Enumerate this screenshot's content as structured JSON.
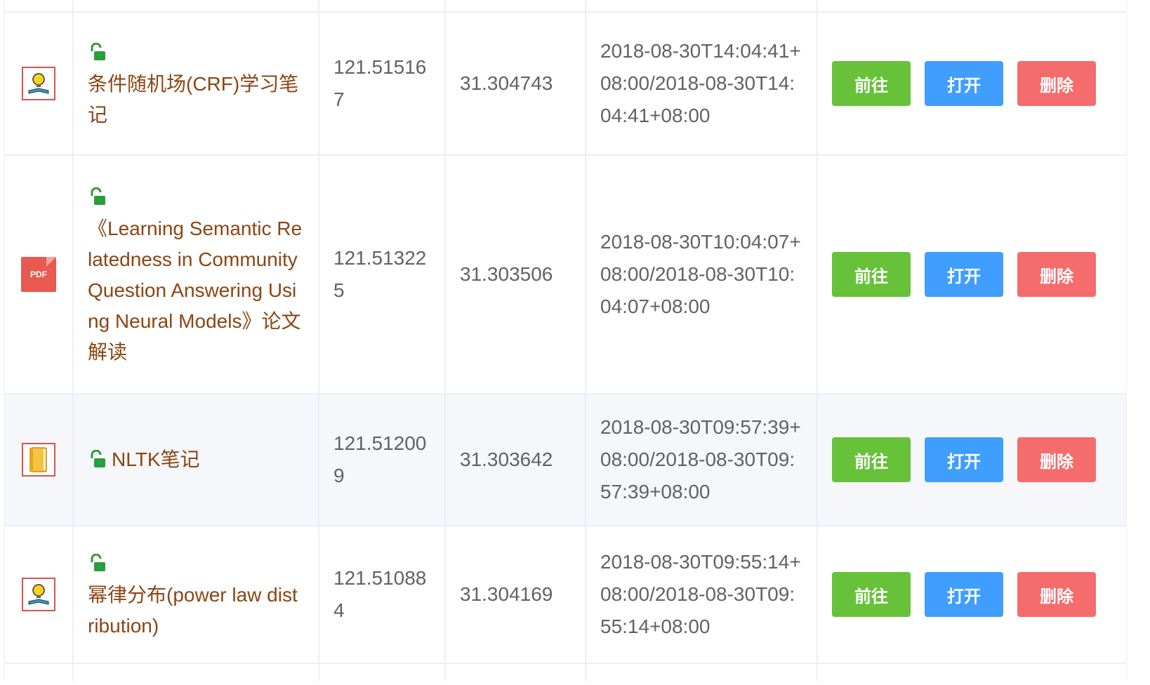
{
  "buttons": {
    "go_label": "前往",
    "open_label": "打开",
    "delete_label": "删除"
  },
  "rows": [
    {
      "icon": "bulb-book-icon",
      "title": "条件随机场(CRF)学习笔记",
      "lon": "121.515167",
      "lat": "31.304743",
      "time": "2018-08-30T14:04:41+08:00/2018-08-30T14:04:41+08:00"
    },
    {
      "icon": "pdf-icon",
      "pdf_text": "PDF",
      "title": "《Learning Semantic Relatedness in Community Question Answering Using Neural Models》论文解读",
      "lon": "121.513225",
      "lat": "31.303506",
      "time": "2018-08-30T10:04:07+08:00/2018-08-30T10:04:07+08:00"
    },
    {
      "icon": "notebook-icon",
      "title": "NLTK笔记",
      "lon": "121.512009",
      "lat": "31.303642",
      "time": "2018-08-30T09:57:39+08:00/2018-08-30T09:57:39+08:00"
    },
    {
      "icon": "bulb-book-icon",
      "title": "幂律分布(power law distribution)",
      "lon": "121.510884",
      "lat": "31.304169",
      "time": "2018-08-30T09:55:14+08:00/2018-08-30T09:55:14+08:00"
    }
  ],
  "colors": {
    "go": "#67c23a",
    "open": "#409eff",
    "delete": "#f56c6c",
    "title": "#8b4513"
  }
}
